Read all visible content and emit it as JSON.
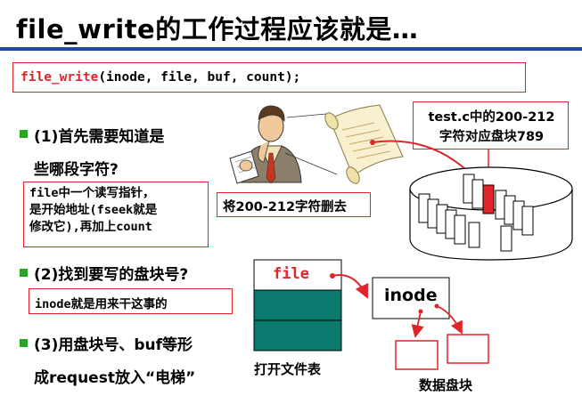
{
  "title": "file_write的工作过程应该就是…",
  "code": {
    "func": "file_write",
    "args": "(inode, file, buf, count);"
  },
  "step1": {
    "line1": "(1)首先需要知道是",
    "line2": "些哪段字符?"
  },
  "callout_file": {
    "line1": "file中一个读写指针，",
    "line2": "是开始地址(fseek就是",
    "line3": "修改它),再加上count"
  },
  "callout_delete": "将200-212字符删去",
  "callout_block": {
    "line1": "test.c中的200-212",
    "line2": "字符对应盘块789"
  },
  "step2": {
    "line1": "(2)找到要写的盘块号?"
  },
  "callout_inode": "inode就是用来干这事的",
  "step3": {
    "line1": "(3)用盘块号、buf等形",
    "line2": "成request放入“电梯”"
  },
  "file_table": {
    "file_label": "file",
    "caption": "打开文件表"
  },
  "inode_label": "inode",
  "data_blocks_caption": "数据盘块",
  "colors": {
    "accent_red": "#e0242a",
    "title_rule": "#1f4aa8",
    "table_teal": "#0b7a6e",
    "bullet_green": "#2aa52a"
  },
  "icons": [
    "person-reading-icon",
    "scroll-icon",
    "disk-cylinder-icon"
  ]
}
